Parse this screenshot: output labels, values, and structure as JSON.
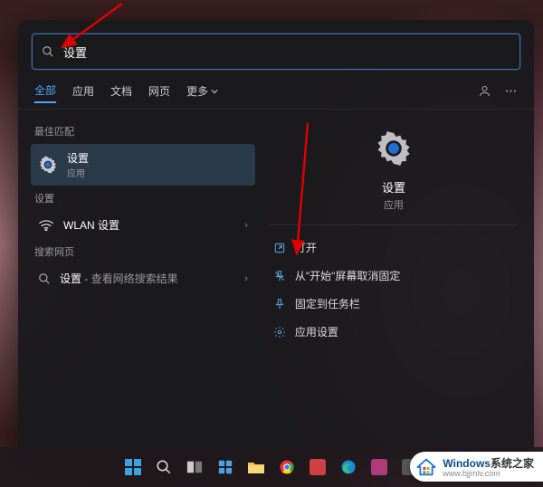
{
  "search": {
    "value": "设置",
    "placeholder": ""
  },
  "tabs": {
    "items": [
      "全部",
      "应用",
      "文档",
      "网页"
    ],
    "more": "更多",
    "active_index": 0
  },
  "left": {
    "best_match_label": "最佳匹配",
    "best_match": {
      "title": "设置",
      "subtitle": "应用"
    },
    "settings_group_label": "设置",
    "settings_item": {
      "title": "WLAN 设置"
    },
    "web_group_label": "搜索网页",
    "web_item": {
      "title": "设置",
      "suffix": " - 查看网络搜索结果"
    }
  },
  "preview": {
    "title": "设置",
    "subtitle": "应用",
    "actions": [
      {
        "icon": "open-icon",
        "label": "打开"
      },
      {
        "icon": "unpin-icon",
        "label": "从\"开始\"屏幕取消固定"
      },
      {
        "icon": "pin-taskbar-icon",
        "label": "固定到任务栏"
      },
      {
        "icon": "app-settings-icon",
        "label": "应用设置"
      }
    ]
  },
  "watermark": {
    "brand": "Windows",
    "brand_suffix": "系统之家",
    "url": "www.bjjmlv.com"
  },
  "colors": {
    "accent": "#4da3ff",
    "panel_bg": "#19191c",
    "action_icon": "#5aa0e0"
  }
}
